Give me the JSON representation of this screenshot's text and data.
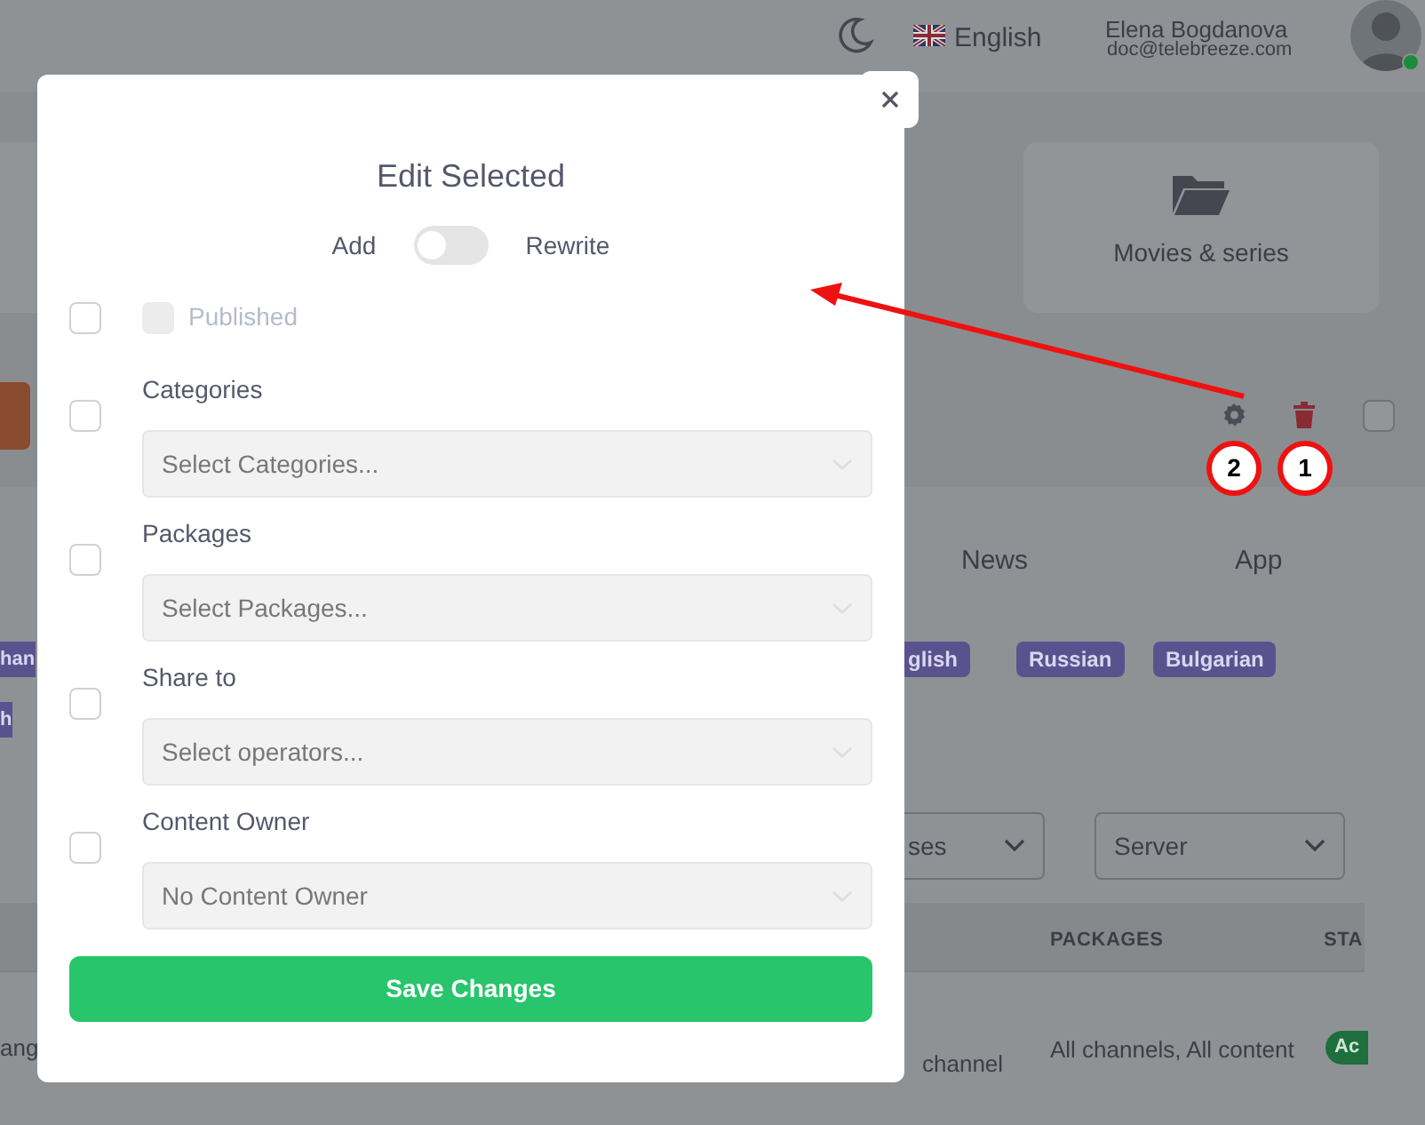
{
  "header": {
    "language": "English",
    "user_name": "Elena Bogdanova",
    "user_email": "doc@telebreeze.com",
    "online": true
  },
  "background": {
    "cards": [
      {
        "label": "Movies & series"
      }
    ],
    "tabs": [
      {
        "label": "News"
      },
      {
        "label": "App"
      }
    ],
    "select_all": {
      "checked": false
    },
    "tags": [
      {
        "label": "han"
      },
      {
        "label": "glish"
      },
      {
        "label": "Russian"
      },
      {
        "label": "Bulgarian"
      },
      {
        "label": "h"
      }
    ],
    "filters": [
      {
        "value": "ses"
      },
      {
        "value": "Server"
      }
    ],
    "table": {
      "columns": [
        "PACKAGES",
        "STA"
      ],
      "row": {
        "cell_1": "ang",
        "cell_2": "channel",
        "packages": "All channels, All content",
        "status": "Ac"
      }
    }
  },
  "annotations": [
    {
      "label": "2"
    },
    {
      "label": "1"
    }
  ],
  "modal": {
    "title": "Edit Selected",
    "mode": {
      "left": "Add",
      "right": "Rewrite",
      "on": false
    },
    "fields": [
      {
        "kind": "checkbox",
        "label": "Published",
        "checked": false,
        "disabled": true
      },
      {
        "kind": "select",
        "label": "Categories",
        "checked": false,
        "placeholder": "Select Categories..."
      },
      {
        "kind": "select",
        "label": "Packages",
        "checked": false,
        "placeholder": "Select Packages..."
      },
      {
        "kind": "select",
        "label": "Share to",
        "checked": false,
        "placeholder": "Select operators..."
      },
      {
        "kind": "select",
        "label": "Content Owner",
        "checked": false,
        "value": "No Content Owner"
      }
    ],
    "save": "Save Changes"
  }
}
